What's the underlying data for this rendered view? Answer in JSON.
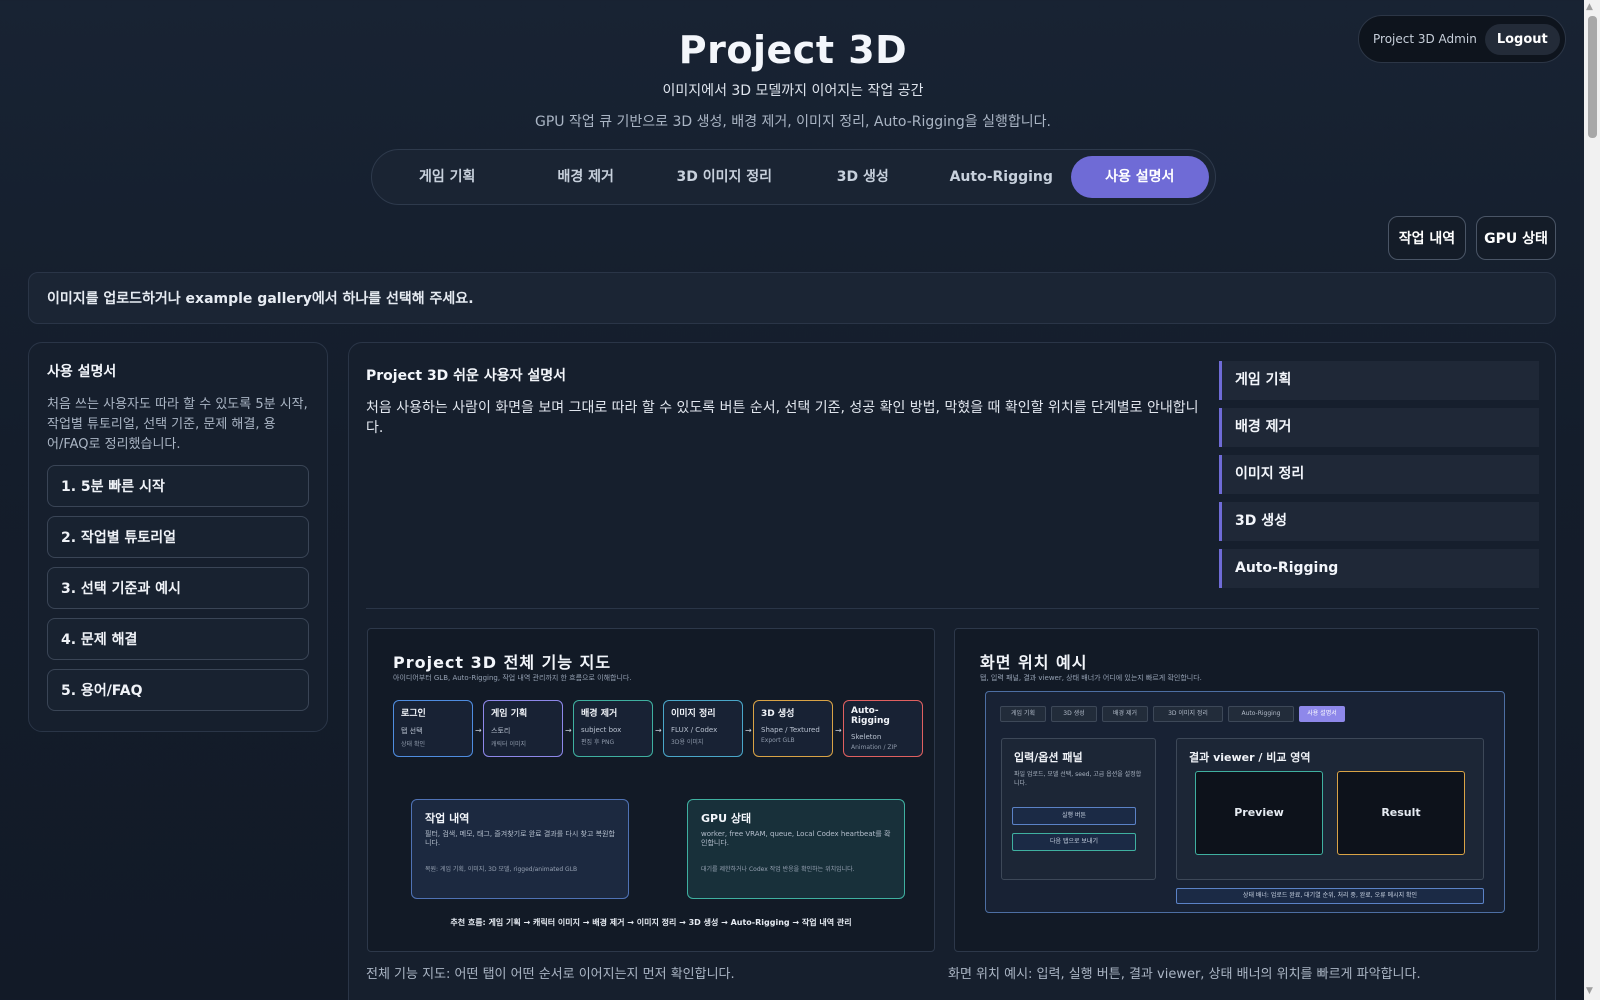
{
  "header": {
    "title": "Project 3D",
    "subtitle": "이미지에서 3D 모델까지 이어지는 작업 공간",
    "description": "GPU 작업 큐 기반으로 3D 생성, 배경 제거, 이미지 정리, Auto-Rigging을 실행합니다."
  },
  "account": {
    "name": "Project 3D Admin",
    "logout_label": "Logout"
  },
  "tabs": [
    {
      "label": "게임 기획"
    },
    {
      "label": "배경 제거"
    },
    {
      "label": "3D 이미지 정리"
    },
    {
      "label": "3D 생성"
    },
    {
      "label": "Auto-Rigging"
    },
    {
      "label": "사용 설명서",
      "active": true
    }
  ],
  "side_buttons": {
    "history": "작업 내역",
    "gpu_status": "GPU 상태"
  },
  "banner": "이미지를 업로드하거나 example gallery에서 하나를 선택해 주세요.",
  "left_panel": {
    "title": "사용 설명서",
    "description": "처음 쓰는 사용자도 따라 할 수 있도록 5분 시작, 작업별 튜토리얼, 선택 기준, 문제 해결, 용어/FAQ로 정리했습니다.",
    "items": [
      "1. 5분 빠른 시작",
      "2. 작업별 튜토리얼",
      "3. 선택 기준과 예시",
      "4. 문제 해결",
      "5. 용어/FAQ"
    ]
  },
  "main": {
    "title": "Project 3D 쉬운 사용자 설명서",
    "description": "처음 사용하는 사람이 화면을 보며 그대로 따라 할 수 있도록 버튼 순서, 선택 기준, 성공 확인 방법, 막혔을 때 확인할 위치를 단계별로 안내합니다.",
    "toc": [
      "게임 기획",
      "배경 제거",
      "이미지 정리",
      "3D 생성",
      "Auto-Rigging"
    ]
  },
  "feature_map": {
    "title": "Project 3D 전체 기능 지도",
    "subtitle": "아이디어부터 GLB, Auto-Rigging, 작업 내역 관리까지 한 흐름으로 이해합니다.",
    "steps": [
      {
        "name": "로그인",
        "line1": "탭 선택",
        "line2": "상태 확인",
        "color": "#4f8de0"
      },
      {
        "name": "게임 기획",
        "line1": "스토리",
        "line2": "캐릭터 이미지",
        "color": "#8e88ea"
      },
      {
        "name": "배경 제거",
        "line1": "subject box",
        "line2": "편집 후 PNG",
        "color": "#3fb0a0"
      },
      {
        "name": "이미지 정리",
        "line1": "FLUX / Codex",
        "line2": "3D용 이미지",
        "color": "#4aa7c9"
      },
      {
        "name": "3D 생성",
        "line1": "Shape / Textured",
        "line2": "Export GLB",
        "color": "#d9a346"
      },
      {
        "name": "Auto-Rigging",
        "line1": "Skeleton",
        "line2": "Animation / ZIP",
        "color": "#e06060"
      }
    ],
    "history_card": {
      "title": "작업 내역",
      "desc": "필터, 검색, 메모, 태그, 즐겨찾기로 완료 결과를 다시 찾고 복원합니다.",
      "note": "복원: 게임 기획, 이미지, 3D 모델, rigged/animated GLB"
    },
    "gpu_card": {
      "title": "GPU 상태",
      "desc": "worker, free VRAM, queue, Local Codex heartbeat를 확인합니다.",
      "note": "대기를 제한하거나 Codex 작업 반응을 확인하는 위치입니다."
    },
    "flow": "추천 흐름: 게임 기획 → 캐릭터 이미지 → 배경 제거 → 이미지 정리 → 3D 생성 → Auto-Rigging → 작업 내역 관리",
    "caption": "전체 기능 지도: 어떤 탭이 어떤 순서로 이어지는지 먼저 확인합니다."
  },
  "screen_map": {
    "title": "화면 위치 예시",
    "subtitle": "탭, 입력 패널, 결과 viewer, 상태 배너가 어디에 있는지 빠르게 확인합니다.",
    "tabs": [
      {
        "label": "게임 기획"
      },
      {
        "label": "3D 생성"
      },
      {
        "label": "배경 제거"
      },
      {
        "label": "3D 이미지 정리"
      },
      {
        "label": "Auto-Rigging"
      },
      {
        "label": "사용 설명서",
        "active": true
      }
    ],
    "input_panel": {
      "title": "입력/옵션 패널",
      "desc": "파일 업로드, 모델 선택, seed, 고급 옵션을 설정합니다.",
      "run_button": "실행 버튼",
      "next_button": "다음 탭으로 보내기"
    },
    "result_panel": {
      "title": "결과 viewer / 비교 영역",
      "preview": "Preview",
      "result": "Result"
    },
    "status_banner": "상태 배너: 업로드 완료, 대기열 순위, 처리 중, 완료, 오류 메시지 확인",
    "caption": "화면 위치 예시: 입력, 실행 버튼, 결과 viewer, 상태 배너의 위치를 빠르게 파악합니다."
  }
}
